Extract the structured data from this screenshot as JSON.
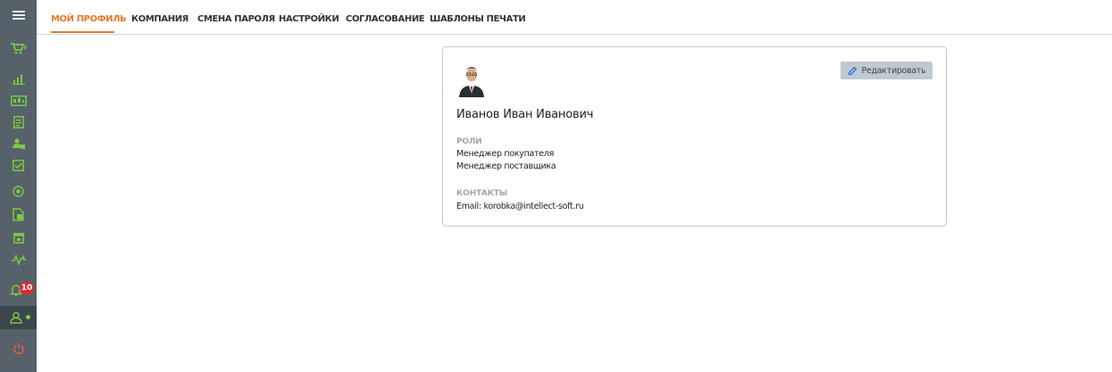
{
  "sidebar": {
    "items": [
      {
        "icon": "menu-icon"
      },
      {
        "icon": "cart-icon"
      },
      {
        "icon": "analytics-icon"
      },
      {
        "icon": "data-panel-icon"
      },
      {
        "icon": "document-icon"
      },
      {
        "icon": "users-icon"
      },
      {
        "icon": "checklist-icon"
      },
      {
        "icon": "target-icon"
      },
      {
        "icon": "file-icon"
      },
      {
        "icon": "calendar-icon"
      },
      {
        "icon": "activity-icon"
      },
      {
        "icon": "notifications-icon",
        "badge": "10"
      },
      {
        "icon": "profile-icon",
        "status": "online"
      },
      {
        "icon": "power-icon"
      }
    ],
    "colors": {
      "background": "#56616a",
      "icon": "#79c943",
      "active": "#3c454c",
      "badge": "#e3262e",
      "power": "#e25b4b"
    }
  },
  "tabs": [
    {
      "label": "МОЙ ПРОФИЛЬ",
      "active": true
    },
    {
      "label": "КОМПАНИЯ"
    },
    {
      "label": "СМЕНА ПАРОЛЯ"
    },
    {
      "label": "НАСТРОЙКИ"
    },
    {
      "label": "СОГЛАСОВАНИЕ"
    },
    {
      "label": "ШАБЛОНЫ ПЕЧАТИ"
    }
  ],
  "accent_color": "#e37b2c",
  "profile": {
    "edit_label": "Редактировать",
    "name": "Иванов Иван Иванович",
    "roles_title": "РОЛИ",
    "roles": [
      "Менеджер покупателя",
      "Менеджер поставщика"
    ],
    "contacts_title": "КОНТАКТЫ",
    "email_line": "Email: korobka@intellect-soft.ru"
  }
}
